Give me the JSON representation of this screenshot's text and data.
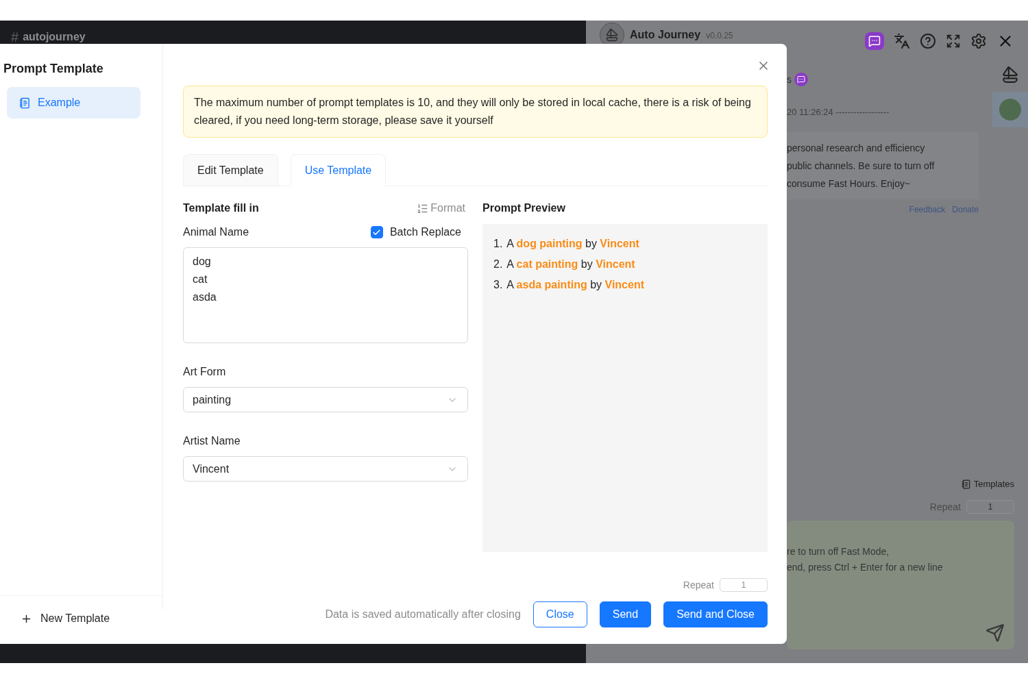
{
  "background": {
    "channel_prefix": "#",
    "channel": "autojourney"
  },
  "panel": {
    "title": "Auto Journey",
    "version": "v0.0.25",
    "chat": {
      "sender_fragment": "s",
      "timestamp": "20 11:26:24 ------------------",
      "message_lines": [
        "personal research and efficiency",
        "public channels. Be sure to turn off",
        "consume Fast Hours. Enjoy~"
      ],
      "links": [
        "Feedback",
        "Donate"
      ]
    },
    "composer": {
      "templates_label": "Templates",
      "repeat_label": "Repeat",
      "repeat_value": "1",
      "input_lines": [
        "re to turn off Fast Mode,",
        "end, press Ctrl + Enter for a new line"
      ]
    }
  },
  "modal": {
    "title": "Prompt Template",
    "items": [
      {
        "label": "Example",
        "selected": true
      }
    ],
    "new_template": "New Template",
    "alert": "The maximum number of prompt templates is 10, and they will only be stored in local cache, there is a risk of being cleared, if you need long-term storage, please save it yourself",
    "tabs": [
      {
        "label": "Edit Template",
        "selected": false
      },
      {
        "label": "Use Template",
        "selected": true
      }
    ],
    "form": {
      "heading": "Template fill in",
      "format": "Format",
      "fields": [
        {
          "kind": "textarea",
          "label": "Animal Name",
          "batch_replace": {
            "label": "Batch Replace",
            "checked": true
          },
          "lines": [
            "dog",
            "cat",
            "asda"
          ]
        },
        {
          "kind": "select",
          "label": "Art Form",
          "value": "painting"
        },
        {
          "kind": "select",
          "label": "Artist Name",
          "value": "Vincent"
        }
      ]
    },
    "preview": {
      "heading": "Prompt Preview",
      "lines": [
        {
          "number": "1.",
          "text": "A **dog painting** by **Vincent**"
        },
        {
          "number": "2.",
          "text": "A **cat painting** by **Vincent**"
        },
        {
          "number": "3.",
          "text": "A **asda painting** by **Vincent**"
        }
      ]
    },
    "footer": {
      "repeat_label": "Repeat",
      "repeat_value": "1",
      "note": "Data is saved automatically after closing",
      "buttons": [
        {
          "label": "Close",
          "kind": "outline"
        },
        {
          "label": "Send",
          "kind": "primary"
        },
        {
          "label": "Send and Close",
          "kind": "primary"
        }
      ]
    }
  }
}
